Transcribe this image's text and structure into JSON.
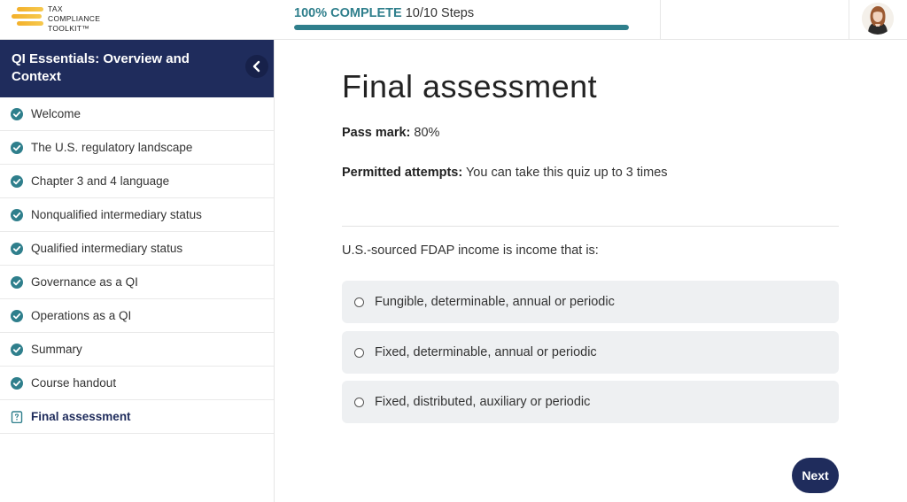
{
  "brand": {
    "logo_lines": [
      "TAX",
      "COMPLIANCE",
      "TOOLKIT™"
    ],
    "accent": "#f3b02a"
  },
  "progress": {
    "percent_label": "100% COMPLETE",
    "steps_label": "10/10 Steps",
    "fraction": 1.0,
    "color": "#2f7f8c"
  },
  "user": {
    "avatar_icon": "user-avatar"
  },
  "sidebar": {
    "course_title": "QI Essentials: Overview and Context",
    "collapse_icon": "chevron-left-icon",
    "header_color": "#1f2c5c",
    "lessons": [
      {
        "label": "Welcome",
        "status": "complete"
      },
      {
        "label": "The U.S. regulatory landscape",
        "status": "complete"
      },
      {
        "label": "Chapter 3 and 4 language",
        "status": "complete"
      },
      {
        "label": "Nonqualified intermediary status",
        "status": "complete"
      },
      {
        "label": "Qualified intermediary status",
        "status": "complete"
      },
      {
        "label": "Governance as a QI",
        "status": "complete"
      },
      {
        "label": "Operations as a QI",
        "status": "complete"
      },
      {
        "label": "Summary",
        "status": "complete"
      },
      {
        "label": "Course handout",
        "status": "complete"
      },
      {
        "label": "Final assessment",
        "status": "current"
      }
    ]
  },
  "main": {
    "title": "Final assessment",
    "pass_mark_label": "Pass mark:",
    "pass_mark_value": "80%",
    "attempts_label": "Permitted attempts:",
    "attempts_value": "You can take this quiz up to 3 times",
    "question": "U.S.-sourced FDAP income is income that is:",
    "options": [
      "Fungible, determinable, annual or periodic",
      "Fixed, determinable, annual or periodic",
      "Fixed, distributed, auxiliary or periodic"
    ],
    "next_label": "Next"
  }
}
